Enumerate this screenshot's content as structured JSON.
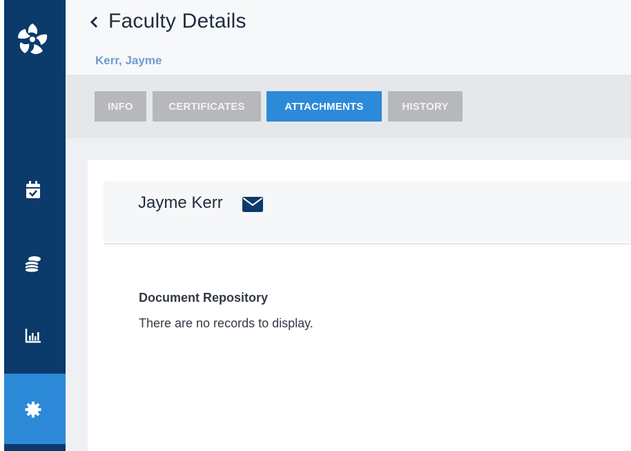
{
  "header": {
    "title": "Faculty Details",
    "subtitle": "Kerr, Jayme"
  },
  "tabs": [
    {
      "label": "INFO",
      "active": false
    },
    {
      "label": "CERTIFICATES",
      "active": false
    },
    {
      "label": "ATTACHMENTS",
      "active": true
    },
    {
      "label": "HISTORY",
      "active": false
    }
  ],
  "profile": {
    "name": "Jayme Kerr"
  },
  "repository": {
    "heading": "Document Repository",
    "empty_message": "There are no records to display."
  },
  "nav": {
    "items": [
      {
        "icon": "calendar-check-icon"
      },
      {
        "icon": "coins-icon"
      },
      {
        "icon": "bar-chart-icon"
      },
      {
        "icon": "gear-icon",
        "active": true
      }
    ]
  },
  "colors": {
    "rail": "#0b3a6b",
    "accent": "#2c8ad8",
    "tab_inactive": "#b7b8bb",
    "link": "#6f9bd1"
  }
}
